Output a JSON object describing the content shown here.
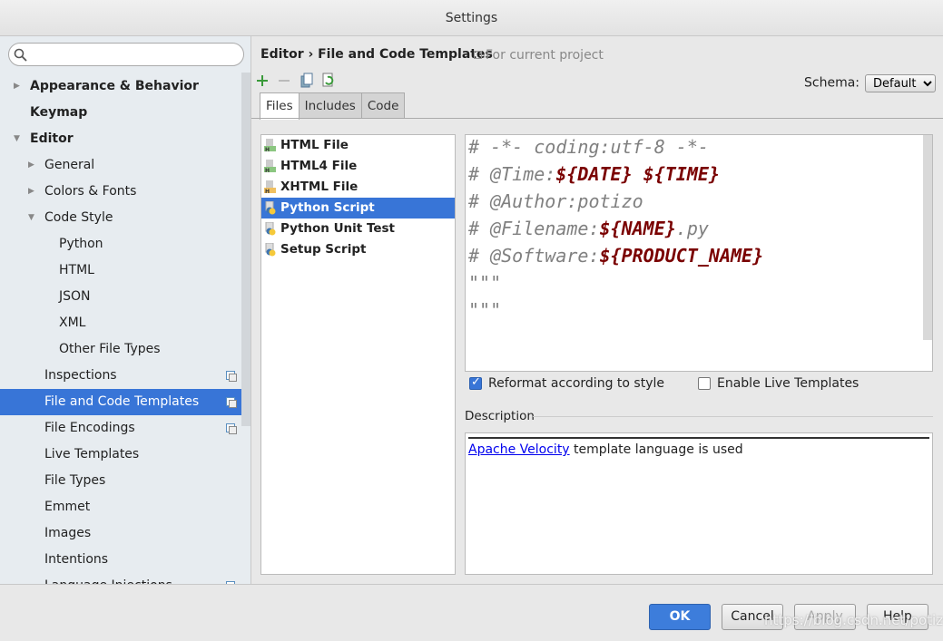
{
  "window": {
    "title": "Settings"
  },
  "sidebar": {
    "search_placeholder": "",
    "items": [
      {
        "label": "Appearance & Behavior",
        "level": 0,
        "bold": true,
        "arrow": "right"
      },
      {
        "label": "Keymap",
        "level": 0,
        "bold": true
      },
      {
        "label": "Editor",
        "level": 0,
        "bold": true,
        "arrow": "down"
      },
      {
        "label": "General",
        "level": 1,
        "arrow": "right"
      },
      {
        "label": "Colors & Fonts",
        "level": 1,
        "arrow": "right"
      },
      {
        "label": "Code Style",
        "level": 1,
        "arrow": "down"
      },
      {
        "label": "Python",
        "level": 2
      },
      {
        "label": "HTML",
        "level": 2
      },
      {
        "label": "JSON",
        "level": 2
      },
      {
        "label": "XML",
        "level": 2
      },
      {
        "label": "Other File Types",
        "level": 2
      },
      {
        "label": "Inspections",
        "level": 1,
        "project": true
      },
      {
        "label": "File and Code Templates",
        "level": 1,
        "project": true,
        "selected": true
      },
      {
        "label": "File Encodings",
        "level": 1,
        "project": true
      },
      {
        "label": "Live Templates",
        "level": 1
      },
      {
        "label": "File Types",
        "level": 1
      },
      {
        "label": "Emmet",
        "level": 1
      },
      {
        "label": "Images",
        "level": 1
      },
      {
        "label": "Intentions",
        "level": 1
      },
      {
        "label": "Language Injections",
        "level": 1,
        "project": true
      }
    ]
  },
  "main": {
    "breadcrumb": "Editor › File and Code Templates",
    "scope": "For current project",
    "schema_label": "Schema:",
    "schema_value": "Default",
    "toolbar": [
      "add-icon",
      "remove-icon",
      "copy-icon",
      "reset-icon"
    ],
    "tabs": [
      {
        "label": "Files",
        "active": true
      },
      {
        "label": "Includes"
      },
      {
        "label": "Code"
      }
    ],
    "files": [
      {
        "label": "HTML File",
        "icon": "html-file-icon"
      },
      {
        "label": "HTML4 File",
        "icon": "html-file-icon"
      },
      {
        "label": "XHTML File",
        "icon": "xhtml-file-icon"
      },
      {
        "label": "Python Script",
        "icon": "python-icon",
        "selected": true
      },
      {
        "label": "Python Unit Test",
        "icon": "python-icon"
      },
      {
        "label": "Setup Script",
        "icon": "python-icon"
      }
    ],
    "code_lines": [
      [
        {
          "t": "# -*- coding:utf-8 -*-"
        }
      ],
      [
        {
          "t": "# @Time:"
        },
        {
          "t": "${DATE} ${TIME}",
          "v": true
        }
      ],
      [
        {
          "t": "# @Author:potizo"
        }
      ],
      [
        {
          "t": "# @Filename:"
        },
        {
          "t": "${NAME}",
          "v": true
        },
        {
          "t": ".py"
        }
      ],
      [
        {
          "t": "# @Software:"
        },
        {
          "t": "${PRODUCT_NAME}",
          "v": true
        }
      ],
      [
        {
          "t": "\"\"\""
        }
      ],
      [
        {
          "t": "\"\"\""
        }
      ]
    ],
    "reformat_label": "Reformat according to style",
    "reformat_checked": true,
    "live_label": "Enable Live Templates",
    "live_checked": false,
    "description_label": "Description",
    "description_link": "Apache Velocity",
    "description_text": " template language is used"
  },
  "footer": {
    "ok": "OK",
    "cancel": "Cancel",
    "apply": "Apply",
    "help": "Help"
  },
  "watermark": "https://blog.csdn.net/potizo",
  "colors": {
    "selection": "#3875d7",
    "variable": "#7a0000",
    "comment": "#808080"
  }
}
